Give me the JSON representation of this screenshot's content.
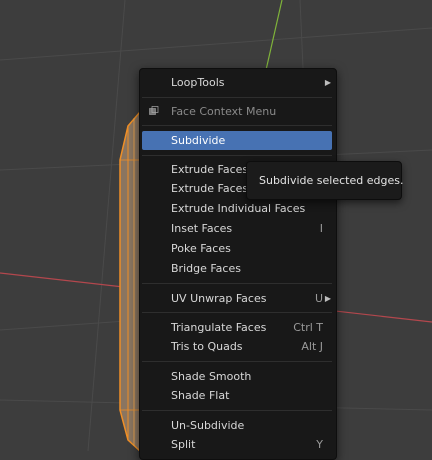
{
  "menu": {
    "items": [
      {
        "label": "LoopTools",
        "shortcut": "",
        "submenu": true
      },
      {
        "label": "Face Context Menu",
        "header": true
      },
      {
        "label": "Subdivide",
        "active": true
      },
      {
        "label": "Extrude Faces",
        "shortcut": ""
      },
      {
        "label": "Extrude Faces A",
        "shortcut": ""
      },
      {
        "label": "Extrude Individual Faces",
        "shortcut": ""
      },
      {
        "label": "Inset Faces",
        "shortcut": "I"
      },
      {
        "label": "Poke Faces",
        "shortcut": ""
      },
      {
        "label": "Bridge Faces",
        "shortcut": ""
      },
      {
        "label": "UV Unwrap Faces",
        "shortcut": "U",
        "submenu": true
      },
      {
        "label": "Triangulate Faces",
        "shortcut": "Ctrl T"
      },
      {
        "label": "Tris to Quads",
        "shortcut": "Alt J"
      },
      {
        "label": "Shade Smooth",
        "shortcut": ""
      },
      {
        "label": "Shade Flat",
        "shortcut": ""
      },
      {
        "label": "Un-Subdivide",
        "shortcut": ""
      },
      {
        "label": "Split",
        "shortcut": "Y"
      }
    ]
  },
  "tooltip": {
    "text": "Subdivide selected edges."
  },
  "colors": {
    "accent": "#4772b3",
    "menu_bg": "#181818",
    "viewport_bg": "#3d3d3d",
    "x_axis": "#b3474d",
    "y_axis": "#7fb33a",
    "selection": "#f08f26"
  },
  "icons": {
    "header_icon": "face-menu-icon",
    "submenu_arrow": "submenu-arrow-icon"
  }
}
